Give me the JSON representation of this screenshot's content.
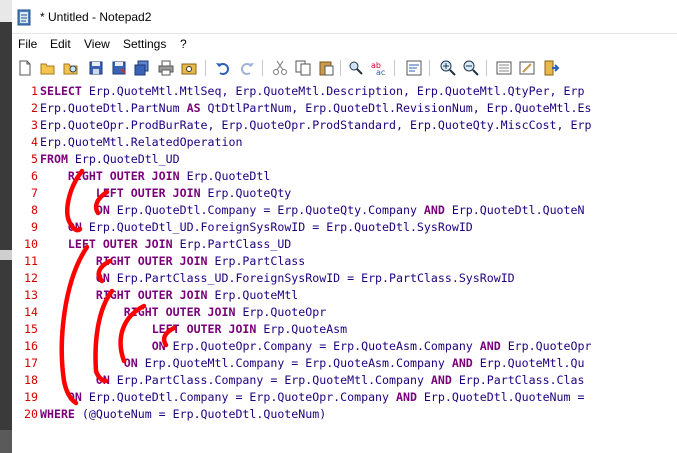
{
  "window": {
    "title": "* Untitled - Notepad2"
  },
  "menu": [
    "File",
    "Edit",
    "View",
    "Settings",
    "?"
  ],
  "toolbar": [
    "new-icon",
    "open-icon",
    "browse-icon",
    "save-icon",
    "save-as-icon",
    "save-copy-icon",
    "print-icon",
    "find-file-icon",
    "undo-icon",
    "redo-icon",
    "cut-icon",
    "copy-icon",
    "paste-icon",
    "find-icon",
    "replace-icon",
    "wordwrap-icon",
    "zoom-in-icon",
    "zoom-out-icon",
    "scheme-icon",
    "customize-icon",
    "exit-icon"
  ],
  "lines": [
    {
      "n": "1",
      "segs": [
        {
          "t": "SELECT ",
          "k": 1
        },
        {
          "t": "Erp.QuoteMtl.MtlSeq, Erp.QuoteMtl.Description, Erp.QuoteMtl.QtyPer, Erp"
        }
      ]
    },
    {
      "n": "2",
      "segs": [
        {
          "t": "Erp.QuoteDtl.PartNum "
        },
        {
          "t": "AS ",
          "k": 1
        },
        {
          "t": "QtDtlPartNum, Erp.QuoteDtl.RevisionNum, Erp.QuoteMtl.Es"
        }
      ]
    },
    {
      "n": "3",
      "segs": [
        {
          "t": "Erp.QuoteOpr.ProdBurRate, Erp.QuoteOpr.ProdStandard, Erp.QuoteQty.MiscCost, Erp"
        }
      ]
    },
    {
      "n": "4",
      "segs": [
        {
          "t": "Erp.QuoteMtl.RelatedOperation"
        }
      ]
    },
    {
      "n": "5",
      "segs": [
        {
          "t": "FROM ",
          "k": 1
        },
        {
          "t": "Erp.QuoteDtl_UD"
        }
      ]
    },
    {
      "n": "6",
      "segs": [
        {
          "t": "    "
        },
        {
          "t": "RIGHT OUTER JOIN ",
          "k": 1
        },
        {
          "t": "Erp.QuoteDtl"
        }
      ]
    },
    {
      "n": "7",
      "segs": [
        {
          "t": "        "
        },
        {
          "t": "LEFT OUTER JOIN ",
          "k": 1
        },
        {
          "t": "Erp.QuoteQty"
        }
      ]
    },
    {
      "n": "8",
      "segs": [
        {
          "t": "        "
        },
        {
          "t": "ON ",
          "k": 1
        },
        {
          "t": "Erp.QuoteDtl.Company = Erp.QuoteQty.Company "
        },
        {
          "t": "AND ",
          "k": 1
        },
        {
          "t": "Erp.QuoteDtl.QuoteN"
        }
      ]
    },
    {
      "n": "9",
      "segs": [
        {
          "t": "    "
        },
        {
          "t": "ON ",
          "k": 1
        },
        {
          "t": "Erp.QuoteDtl_UD.ForeignSysRowID = Erp.QuoteDtl.SysRowID"
        }
      ]
    },
    {
      "n": "10",
      "segs": [
        {
          "t": "    "
        },
        {
          "t": "LEFT OUTER JOIN ",
          "k": 1
        },
        {
          "t": "Erp.PartClass_UD"
        }
      ]
    },
    {
      "n": "11",
      "segs": [
        {
          "t": "        "
        },
        {
          "t": "RIGHT OUTER JOIN ",
          "k": 1
        },
        {
          "t": "Erp.PartClass"
        }
      ]
    },
    {
      "n": "12",
      "segs": [
        {
          "t": "        "
        },
        {
          "t": "ON ",
          "k": 1
        },
        {
          "t": "Erp.PartClass_UD.ForeignSysRowID = Erp.PartClass.SysRowID"
        }
      ]
    },
    {
      "n": "13",
      "segs": [
        {
          "t": "        "
        },
        {
          "t": "RIGHT OUTER JOIN ",
          "k": 1
        },
        {
          "t": "Erp.QuoteMtl"
        }
      ]
    },
    {
      "n": "14",
      "segs": [
        {
          "t": "            "
        },
        {
          "t": "RIGHT OUTER JOIN ",
          "k": 1
        },
        {
          "t": "Erp.QuoteOpr"
        }
      ]
    },
    {
      "n": "15",
      "segs": [
        {
          "t": "                "
        },
        {
          "t": "LEFT OUTER JOIN ",
          "k": 1
        },
        {
          "t": "Erp.QuoteAsm"
        }
      ]
    },
    {
      "n": "16",
      "segs": [
        {
          "t": "                "
        },
        {
          "t": "ON ",
          "k": 1
        },
        {
          "t": "Erp.QuoteOpr.Company = Erp.QuoteAsm.Company "
        },
        {
          "t": "AND ",
          "k": 1
        },
        {
          "t": "Erp.QuoteOpr"
        }
      ]
    },
    {
      "n": "17",
      "segs": [
        {
          "t": "            "
        },
        {
          "t": "ON ",
          "k": 1
        },
        {
          "t": "Erp.QuoteMtl.Company = Erp.QuoteAsm.Company "
        },
        {
          "t": "AND ",
          "k": 1
        },
        {
          "t": "Erp.QuoteMtl.Qu"
        }
      ]
    },
    {
      "n": "18",
      "segs": [
        {
          "t": "        "
        },
        {
          "t": "ON ",
          "k": 1
        },
        {
          "t": "Erp.PartClass.Company = Erp.QuoteMtl.Company "
        },
        {
          "t": "AND ",
          "k": 1
        },
        {
          "t": "Erp.PartClass.Clas"
        }
      ]
    },
    {
      "n": "19",
      "segs": [
        {
          "t": "    "
        },
        {
          "t": "ON ",
          "k": 1
        },
        {
          "t": "Erp.QuoteDtl.Company = Erp.QuoteOpr.Company "
        },
        {
          "t": "AND ",
          "k": 1
        },
        {
          "t": "Erp.QuoteDtl.QuoteNum ="
        }
      ]
    },
    {
      "n": "20",
      "segs": [
        {
          "t": "WHERE ",
          "k": 1
        },
        {
          "t": "(@QuoteNum = Erp.QuoteDtl.QuoteNum)"
        }
      ]
    }
  ],
  "colors": {
    "linenum": "#d40000",
    "keyword": "#7a007a",
    "identifier": "#200080",
    "annotation": "#ff0000"
  }
}
